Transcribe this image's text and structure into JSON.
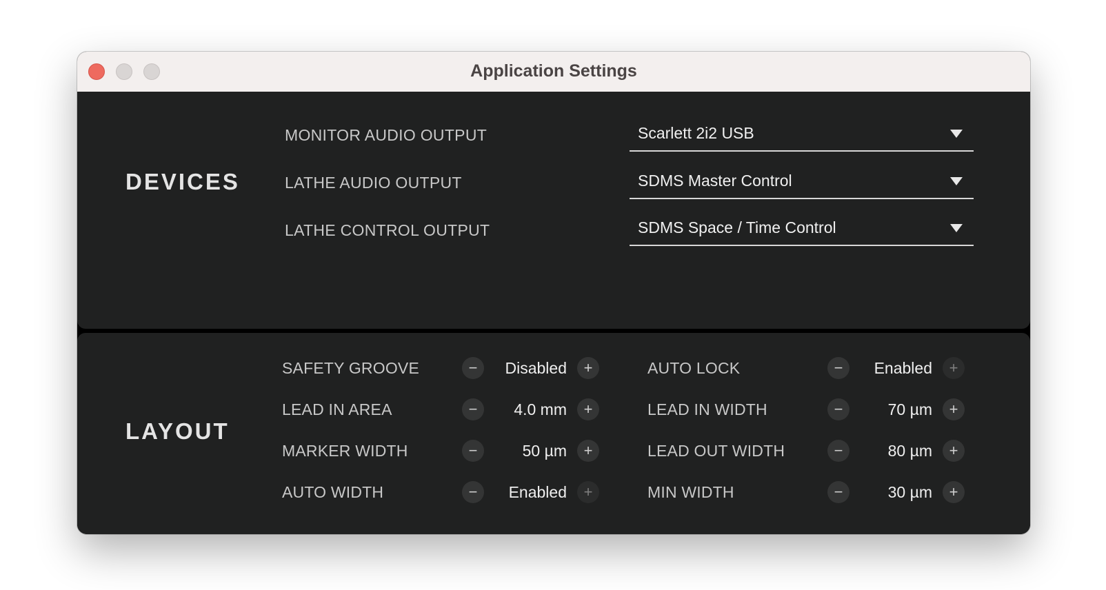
{
  "window": {
    "title": "Application Settings"
  },
  "devices": {
    "title": "DEVICES",
    "rows": [
      {
        "label": "MONITOR AUDIO OUTPUT",
        "value": "Scarlett 2i2 USB"
      },
      {
        "label": "LATHE AUDIO OUTPUT",
        "value": "SDMS Master Control"
      },
      {
        "label": "LATHE CONTROL OUTPUT",
        "value": "SDMS Space / Time Control"
      }
    ]
  },
  "layout": {
    "title": "LAYOUT",
    "left": [
      {
        "label": "SAFETY GROOVE",
        "value": "Disabled"
      },
      {
        "label": "LEAD IN AREA",
        "value": "4.0 mm"
      },
      {
        "label": "MARKER WIDTH",
        "value": "50 µm"
      },
      {
        "label": "AUTO WIDTH",
        "value": "Enabled"
      }
    ],
    "right": [
      {
        "label": "AUTO LOCK",
        "value": "Enabled"
      },
      {
        "label": "LEAD IN WIDTH",
        "value": "70 µm"
      },
      {
        "label": "LEAD OUT WIDTH",
        "value": "80 µm"
      },
      {
        "label": "MIN WIDTH",
        "value": "30 µm"
      }
    ]
  },
  "icons": {
    "minus": "−",
    "plus": "+"
  },
  "colors": {
    "close": "#ee6a5f",
    "panel": "#202121",
    "titlebar": "#f3efee"
  }
}
